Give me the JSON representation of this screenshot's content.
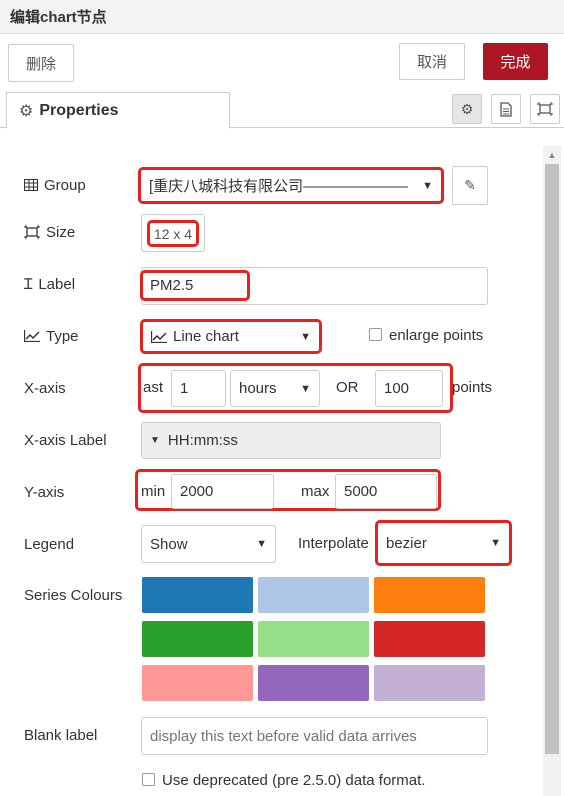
{
  "title": "编辑chart节点",
  "buttons": {
    "delete": "删除",
    "cancel": "取消",
    "done": "完成"
  },
  "tab": {
    "label": "Properties"
  },
  "form": {
    "group": {
      "label": "Group",
      "value": "[重庆八城科技有限公司———————"
    },
    "size": {
      "label": "Size",
      "value": "12 x 4"
    },
    "label": {
      "label": "Label",
      "value": "PM2.5"
    },
    "type": {
      "label": "Type",
      "value": "Line chart",
      "enlarge": "enlarge points"
    },
    "xaxis": {
      "label": "X-axis",
      "prefix": "ast",
      "amount": "1",
      "unit": "hours",
      "or": "OR",
      "points_value": "100",
      "points_label": "points"
    },
    "xaxis_label": {
      "label": "X-axis Label",
      "value": "HH:mm:ss"
    },
    "yaxis": {
      "label": "Y-axis",
      "min_label": "min",
      "min": "2000",
      "max_label": "max",
      "max": "5000"
    },
    "legend": {
      "label": "Legend",
      "value": "Show",
      "interpolate_label": "Interpolate",
      "interpolate": "bezier"
    },
    "series": {
      "label": "Series Colours",
      "colors": [
        "#1f77b4",
        "#aec7e8",
        "#ff7f0e",
        "#2ca02c",
        "#98df8a",
        "#d62728",
        "#ff9896",
        "#9467bd",
        "#c5b0d5"
      ]
    },
    "blank": {
      "label": "Blank label",
      "placeholder": "display this text before valid data arrives"
    },
    "deprecated": {
      "label": "Use deprecated (pre 2.5.0) data format."
    }
  }
}
